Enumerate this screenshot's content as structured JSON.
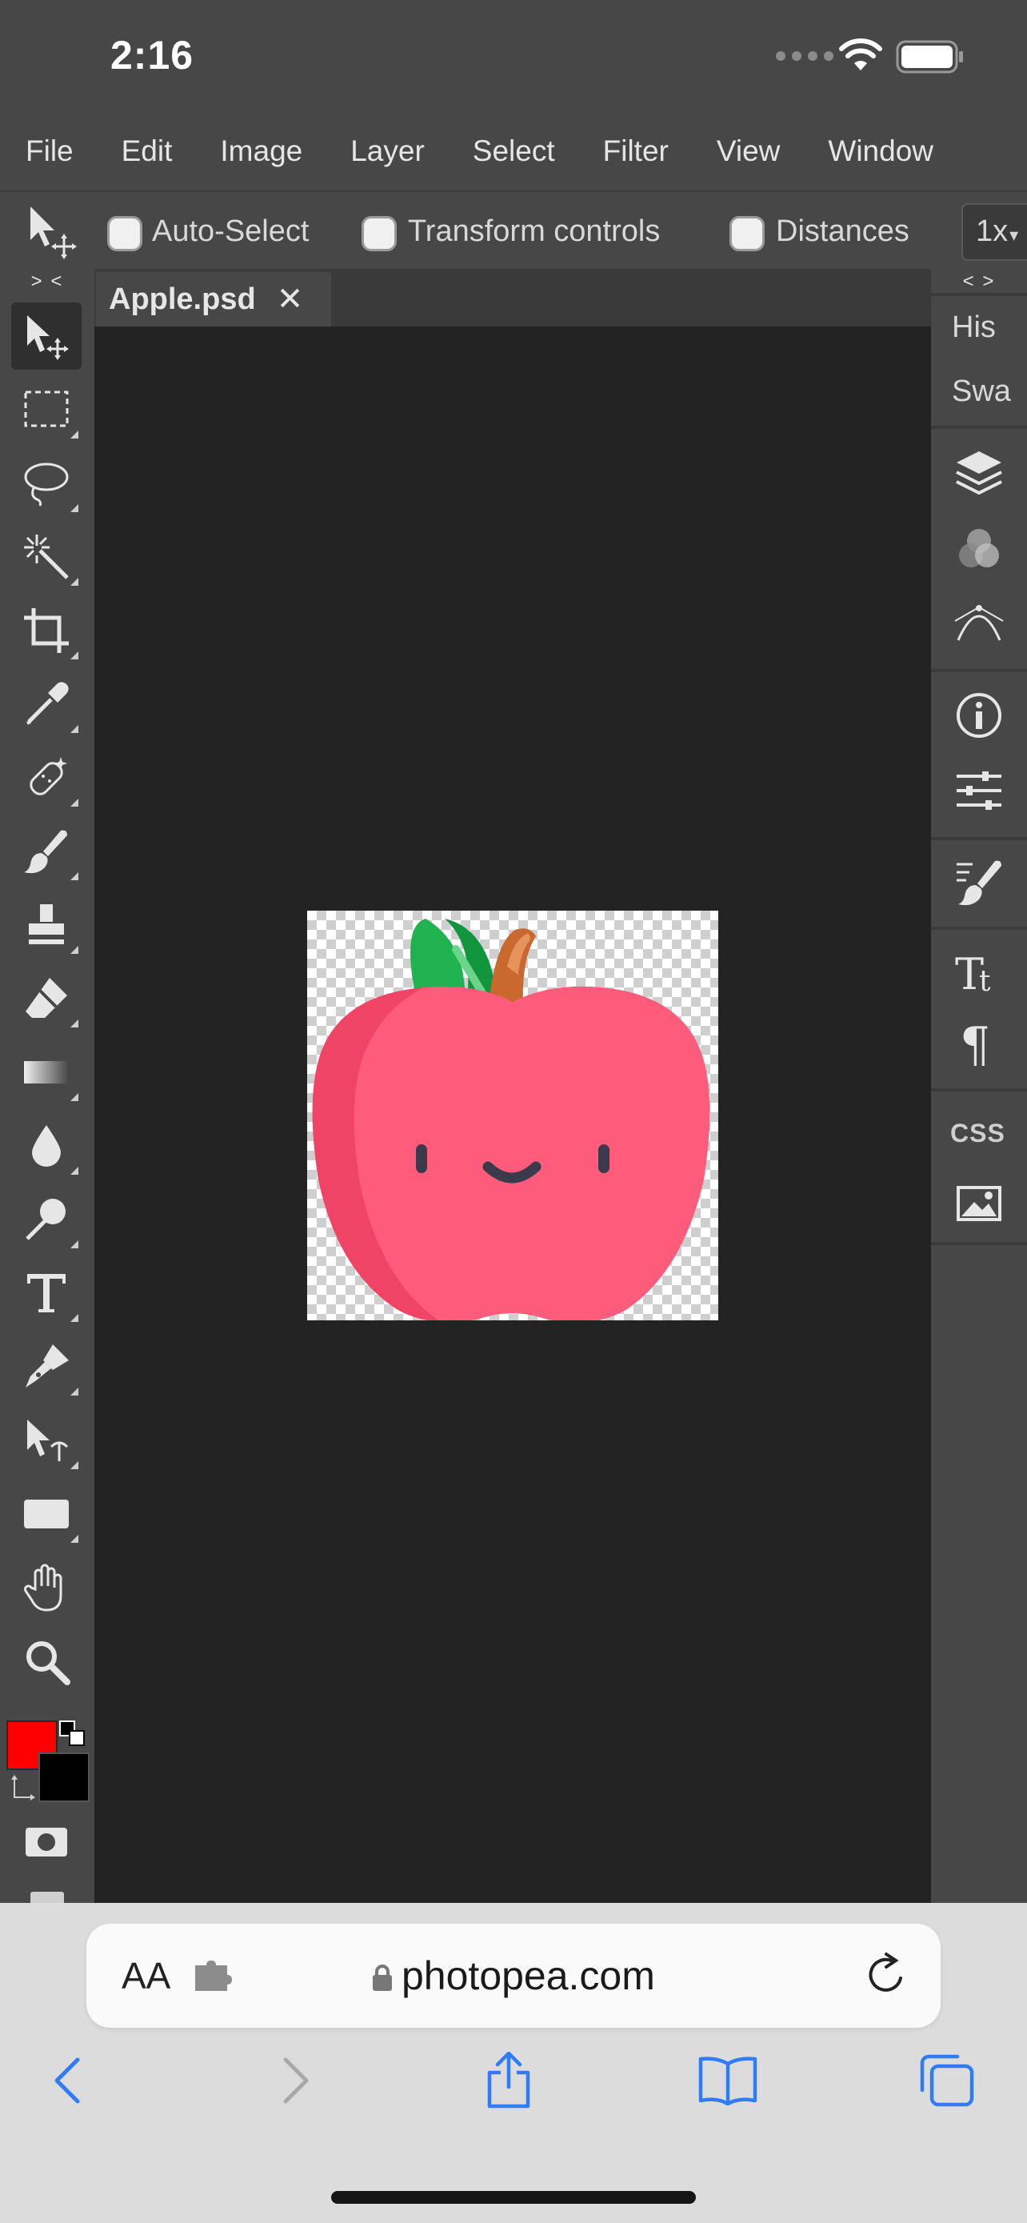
{
  "status_bar": {
    "time": "2:16"
  },
  "menu": {
    "items": [
      "File",
      "Edit",
      "Image",
      "Layer",
      "Select",
      "Filter",
      "View",
      "Window"
    ]
  },
  "options_bar": {
    "auto_select": "Auto-Select",
    "transform_controls": "Transform controls",
    "distances": "Distances",
    "zoom": "1x"
  },
  "toolbar": {
    "collapse_label": "> <",
    "tools": [
      "move-tool",
      "marquee-tool",
      "lasso-tool",
      "magic-wand-tool",
      "crop-tool",
      "eyedropper-tool",
      "healing-tool",
      "brush-tool",
      "stamp-tool",
      "eraser-tool",
      "gradient-tool",
      "blur-tool",
      "dodge-tool",
      "type-tool",
      "pen-tool",
      "path-select-tool",
      "rectangle-tool",
      "hand-tool",
      "zoom-tool"
    ],
    "foreground_color": "#ff0000",
    "background_color": "#000000"
  },
  "document": {
    "tab_name": "Apple.psd",
    "close_symbol": "✕"
  },
  "right_panel": {
    "collapse_label": "< >",
    "history_label": "His",
    "swatches_label": "Swa",
    "css_label": "CSS"
  },
  "browser": {
    "aa_label": "AA",
    "host": "photopea.com"
  }
}
